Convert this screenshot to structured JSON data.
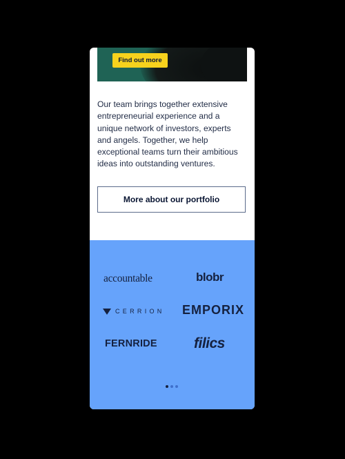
{
  "hero": {
    "cta_label": "Find out more"
  },
  "intro": {
    "text": "Our team brings together extensive entrepreneurial experience and a unique network of investors, experts and angels. Together, we help exceptional teams turn their ambitious ideas into outstanding ventures."
  },
  "portfolio_button": {
    "label": "More about our portfolio"
  },
  "logos": [
    {
      "name": "accountable"
    },
    {
      "name": "blobr"
    },
    {
      "name": "CERRION"
    },
    {
      "name": "EMPORIX"
    },
    {
      "name": "FERNRIDE"
    },
    {
      "name": "filics"
    }
  ],
  "carousel": {
    "dot_count": 3,
    "active_index": 0
  },
  "colors": {
    "page_background": "#000000",
    "hero_green": "#1f6355",
    "cta_yellow": "#f7d21d",
    "text_navy": "#1f2a44",
    "logos_panel_blue": "#66a3fb"
  }
}
